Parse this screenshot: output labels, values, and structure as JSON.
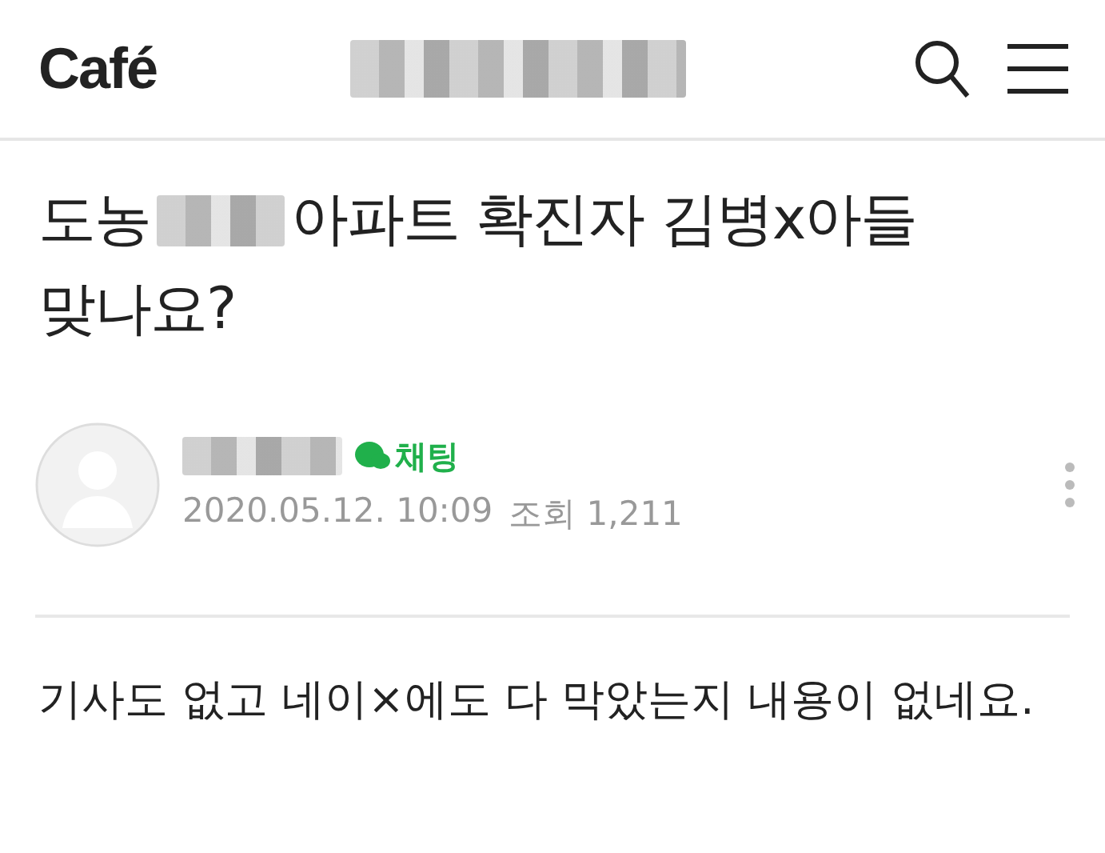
{
  "header": {
    "logo": "Café"
  },
  "post": {
    "title_lines": [
      [
        "도농",
        "아파트 확진자 김병x아들"
      ],
      [
        "맞나요?"
      ]
    ],
    "author": {
      "chat_label": "채팅",
      "date": "2020.05.12. 10:09",
      "views_label": "조회",
      "views": "1,211"
    },
    "body": "기사도 없고 네이×에도 다 막았는지 내용이 없네요."
  }
}
